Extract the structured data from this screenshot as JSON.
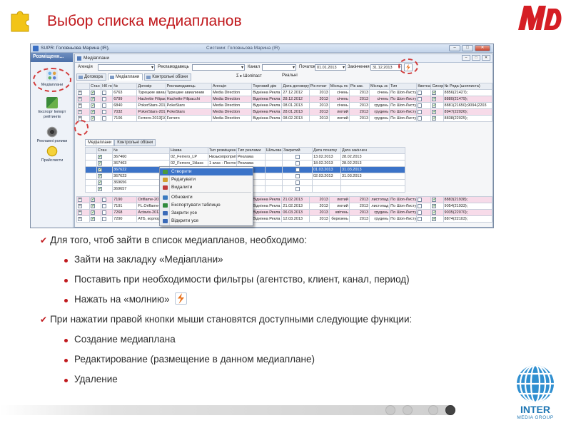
{
  "slide": {
    "title": "Выбор списка медиапланов",
    "brand_color": "#c0171b"
  },
  "app": {
    "title": "SUPR: Головньова Марина (IR),",
    "title_extra": "Системи: Головньова Марина (IR)",
    "left_panel": {
      "header": "Розміщенн...",
      "items": [
        {
          "label": "Медіаплани",
          "icon": "mediaplans-icon"
        },
        {
          "label": "Експорт Імпорт рейтингів",
          "icon": "export-import-icon"
        },
        {
          "label": "Рекламні ролики",
          "icon": "film-reel-icon"
        },
        {
          "label": "Прайслисти",
          "icon": "coin-icon"
        }
      ]
    },
    "window": {
      "title": "Медіаплани",
      "filters": {
        "agency_label": "Агенція",
        "advertiser_label": "Рекламодавець",
        "channel_label": "Канал",
        "start_label": "Початок",
        "start_value": "01.01.2013",
        "end_label": "Закінчення",
        "end_value": "31.12.2013"
      },
      "tabs": [
        "Договора",
        "Медіаплани",
        "Контрольні обізни"
      ],
      "toolbar_extra": [
        "Σ ▸ Шопіпаст",
        "Реальні"
      ],
      "columns": [
        "Стан",
        "НК поз",
        "№",
        "Договір",
        "Рекламодавець",
        "Агенція",
        "Торговий дім",
        "Дата договору",
        "Рік почат",
        "Місяць пс",
        "Рік зак.",
        "Місяць зс",
        "Тип",
        "Квотна р",
        "Синхро",
        "№ Ряда (шопписта)"
      ],
      "rows": [
        {
          "num": "6763",
          "contract": "Турецкие авиали",
          "advertiser": "Турецкие авиалинии",
          "agency": "Media Direction",
          "house": "Віднінна Рекла",
          "date": "27.12.2012",
          "y1": "2013",
          "m1": "січень",
          "y2": "2013",
          "m2": "січень",
          "type": "По Шоп-Листу",
          "rowno": "8856(21427);",
          "pink": false
        },
        {
          "num": "6799",
          "contract": "Hachette Filipacchi",
          "advertiser": "Hachette Filipacchi",
          "agency": "Media Direction",
          "house": "Віднінна Рекла",
          "date": "28.12.2012",
          "y1": "2013",
          "m1": "січень",
          "y2": "2013",
          "m2": "січень",
          "type": "По Шоп-Листу",
          "rowno": "8880(21479);",
          "pink": true
        },
        {
          "num": "6840",
          "contract": "PokerStars-2013[1]",
          "advertiser": "PokeStars",
          "agency": "Media Direction",
          "house": "Віднінна Рекла",
          "date": "08.01.2013",
          "y1": "2013",
          "m1": "січень",
          "y2": "2013",
          "m2": "грудень",
          "type": "По Шоп-Листу",
          "rowno": "8881(21650);9094(2203",
          "pink": false
        },
        {
          "num": "7032",
          "contract": "PokerStars-2013 L",
          "advertiser": "PokeStars",
          "agency": "Media Direction",
          "house": "Віднінна Рекла",
          "date": "28.01.2013",
          "y1": "2013",
          "m1": "лютий",
          "y2": "2013",
          "m2": "грудень",
          "type": "По Шоп-Листу",
          "rowno": "8947(22026);",
          "pink": true
        },
        {
          "num": "7106",
          "contract": "Ferrero-2013[100]",
          "advertiser": "Ferrero",
          "agency": "Media Direction",
          "house": "Віднінна Рекла",
          "date": "08.02.2013",
          "y1": "2013",
          "m1": "лютий",
          "y2": "2013",
          "m2": "грудень",
          "type": "По Шоп-Листу",
          "rowno": "8838(22025);",
          "pink": false
        }
      ],
      "sub": {
        "tabs": [
          "Медіаплани",
          "Контрольні обізни"
        ],
        "columns": [
          "Стан",
          "№",
          "Назва",
          "Тип розміщення",
          "Тип реклами",
          "Шільова ауд",
          "Закритий",
          "Дата початку",
          "Дата закінчен",
          "Відповідальна особа"
        ],
        "rows": [
          {
            "num": "367460",
            "name": "02_Ferrero_LP",
            "type": "Низькопропритетне р",
            "adtype": "Реклама",
            "start": "13.02.2013",
            "end": "28.02.2013",
            "person": "Катерина Богдан"
          },
          {
            "num": "367463",
            "name": "02_Ferrero_1klass",
            "type": "1 клас - Постолне р",
            "adtype": "Реклама",
            "start": "18.02.2013",
            "end": "28.02.2013",
            "person": "Катерина Богдан"
          },
          {
            "num": "367622",
            "name": "03_Ferrero_LP",
            "type": "Низькопропритетне р",
            "adtype": "Реклама",
            "start": "01.03.2013",
            "end": "31.03.2013",
            "person": "Марина Головньова",
            "selected": true
          },
          {
            "num": "367623",
            "name": "03_Ferrero_1klass",
            "type": "",
            "adtype": "",
            "start": "02.03.2013",
            "end": "31.03.2013",
            "person": "Марина Головньова"
          },
          {
            "num": "369656",
            "name": "04_Ferrero_LP",
            "type": "",
            "adtype": "",
            "start": "",
            "end": "",
            "person": "Марина Головньова"
          },
          {
            "num": "369657",
            "name": "04_Ferrero_1klass",
            "type": "",
            "adtype": "",
            "start": "",
            "end": "",
            "person": "Марина Головньова"
          }
        ]
      },
      "rows_after": [
        {
          "num": "7190",
          "contract": "Oriflame-2013[1] О",
          "house": "Віднінна Рекла",
          "date": "21.02.2013",
          "y1": "2013",
          "m1": "лютий",
          "y2": "2013",
          "m2": "листопад",
          "type": "По Шоп-Листу",
          "rowno": "8883(21938);",
          "pink": true
        },
        {
          "num": "7191",
          "contract": "FL.Oriflame-2013[1] О",
          "house": "Віднінна Рекла",
          "date": "21.02.2013",
          "y1": "2013",
          "m1": "лютий",
          "y2": "2013",
          "m2": "листопад",
          "type": "По Шоп-Листу",
          "rowno": "9054(21933);",
          "pink": false
        },
        {
          "num": "7268",
          "contract": "Actavis-2013[100] А",
          "house": "Віднінна Рекла",
          "date": "06.03.2013",
          "y1": "2013",
          "m1": "квітень",
          "y2": "2013",
          "m2": "грудень",
          "type": "По Шоп-Листу",
          "rowno": "9035(22070);",
          "pink": true
        },
        {
          "num": "7290",
          "contract": "АТБ, корпорація -А",
          "house": "Віднінна Рекла",
          "date": "12.03.2013",
          "y1": "2013",
          "m1": "березень",
          "y2": "2013",
          "m2": "грудень",
          "type": "По Шоп-Листу",
          "rowno": "8874(22103);",
          "pink": false
        }
      ],
      "context_menu": [
        {
          "label": "Створити",
          "highlighted": true,
          "icon_color": "#4a9a3a"
        },
        {
          "label": "Редагувати",
          "icon_color": "#d2a030"
        },
        {
          "label": "Видалити",
          "icon_color": "#c03a3a"
        },
        {
          "label": "Обновити",
          "icon_color": "#3a7ac0"
        },
        {
          "label": "Експортувати таблицю",
          "icon_color": "#2e8a3e"
        },
        {
          "label": "Закрити усе",
          "icon_color": "#3a6ab8"
        },
        {
          "label": "Відкрити усе",
          "icon_color": "#3a6ab8"
        }
      ]
    }
  },
  "bullets": {
    "intro": "Для того, чтоб зайти в список медиапланов, необходимо:",
    "steps": [
      "Зайти на закладку «Медіаплани»",
      "Поставить при необходимости фильтры (агентство, клиент, канал, период)",
      "Нажать на «молнию»"
    ],
    "intro2": "При нажатии правой кнопки мыши становятся доступными следующие функции:",
    "functions": [
      "Создание медиаплана",
      "Редактирование (размещение в данном медиаплане)",
      "Удаление"
    ]
  },
  "footer": {
    "logo_main": "INTER",
    "logo_sub": "MEDIA GROUP"
  }
}
